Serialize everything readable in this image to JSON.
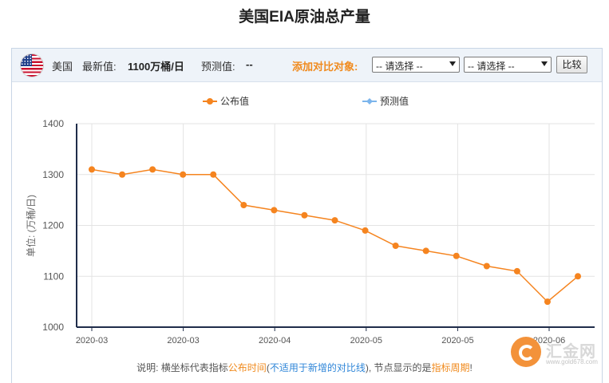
{
  "title": "美国EIA原油总产量",
  "header": {
    "country": "美国",
    "latest_label": "最新值:",
    "latest_value": "1100万桶/日",
    "forecast_label": "预测值:",
    "forecast_value": "--",
    "compare_label": "添加对比对象:",
    "select1": "-- 请选择 --",
    "select2": "-- 请选择 --",
    "compare_button": "比较"
  },
  "note": {
    "p1": "说明: 横坐标代表指标",
    "p2": "公布时间",
    "p3": "(",
    "p4": "不适用于新增的对比线",
    "p5": "), 节点显示的是",
    "p6": "指标周期",
    "p7": "!"
  },
  "logo": {
    "text": "汇金网",
    "url": "www.gold678.com"
  },
  "colors": {
    "series": "#f5841f",
    "forecast": "#7cb5ec",
    "axis": "#1f2d4a",
    "grid": "#e3e3e3",
    "accent": "#f08a1d"
  },
  "chart_data": {
    "type": "line",
    "ylabel": "单位: (万桶/日)",
    "ylim": [
      1000,
      1400
    ],
    "yticks": [
      1000,
      1100,
      1200,
      1300,
      1400
    ],
    "xticks": [
      "2020-03",
      "2020-03",
      "2020-04",
      "2020-05",
      "2020-05",
      "2020-06"
    ],
    "legend_position": "top-center",
    "grid": true,
    "series": [
      {
        "name": "公布值",
        "values": [
          1310,
          1300,
          1310,
          1300,
          1300,
          1240,
          1230,
          1220,
          1210,
          1190,
          1160,
          1150,
          1140,
          1120,
          1110,
          1050,
          1100
        ]
      },
      {
        "name": "预测值",
        "values": []
      }
    ]
  }
}
